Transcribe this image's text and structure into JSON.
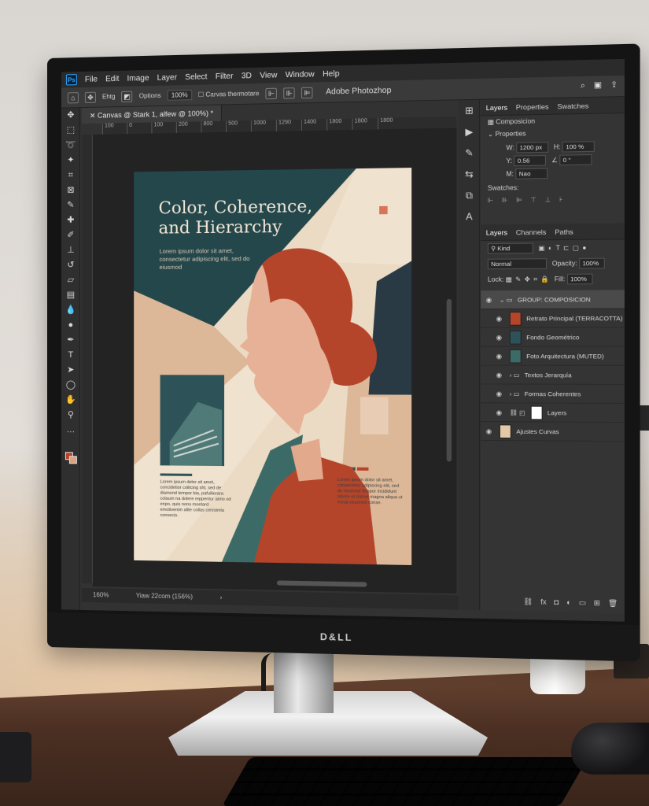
{
  "app": {
    "title": "Adobe Photozhop",
    "logo": "Ps",
    "monitor_brand": "D&LL"
  },
  "menu": [
    "File",
    "Edit",
    "Image",
    "Layer",
    "Select",
    "Filter",
    "3D",
    "View",
    "Window",
    "Help"
  ],
  "options_bar": {
    "options_label": "Options",
    "zoom_value": "100%",
    "canvas_checkbox_label": "Carvas thermotare",
    "brush_label": "Ehtg"
  },
  "document": {
    "tab_label": "Canvas @ Stark 1, alfew @ 100%) *",
    "ruler_ticks": [
      "100",
      "0",
      "100",
      "200",
      "800",
      "500",
      "1000",
      "1290",
      "1400",
      "1800",
      "1800",
      "1800"
    ],
    "status_zoom": "160%",
    "status_doc": "Yiaw 22com (156%)"
  },
  "poster": {
    "title": "Color, Coherence, and Hierarchy",
    "subtitle": "Lorem ipsum dolor sit amet, consectetur adipiscing elit, sed do eiusmod",
    "body_left": "Lorem ipsum deler sit amet, concidetior coilicing sht, sed de diamond tempor bia, pafuiliorara colaum na dolere reppentur aimo od enpo, quis nons moetard emotivenim alite collas cenlsimla consecis.",
    "body_right": "Lorem ipsum dolor sit amet, consectetur adipiscing elit, sed do eiusmod tempor incididunt labore et dolore magna aliqua ut ennat eiusmod conse."
  },
  "properties_panel": {
    "tabs": [
      "Layers",
      "Properties",
      "Swatches"
    ],
    "composite_label": "Composicion",
    "section_label": "Properties",
    "w_value": "1200 px",
    "h_value": "100 %",
    "y_value": "0.56",
    "angle_value": "0 °",
    "misc_value": "Nao",
    "swatches_label": "Swatches:"
  },
  "layers_panel": {
    "tabs": [
      "Layers",
      "Channels",
      "Paths"
    ],
    "filter_label": "Kind",
    "blend_mode": "Normal",
    "opacity_label": "Opacity:",
    "opacity_value": "100%",
    "lock_label": "Lock:",
    "fill_label": "Fill:",
    "fill_value": "100%",
    "layers": [
      {
        "name": "GROUP: COMPOSICION",
        "thumb": "#cfcfcf",
        "selected": true
      },
      {
        "name": "Retrato Principal (TERRACOTTA)",
        "thumb": "#b5452a"
      },
      {
        "name": "Fondo Geométrico",
        "thumb": "#2d5358"
      },
      {
        "name": "Foto Arquitectura (MUTED)",
        "thumb": "#3c6a66"
      },
      {
        "name": "Textos Jerarquía",
        "thumb": "#5a5a5a"
      },
      {
        "name": "Formas Coherentes",
        "thumb": "#5a5a5a"
      },
      {
        "name": "Layers",
        "thumb": "#ffffff"
      },
      {
        "name": "Ajustes Curvas",
        "thumb": "#e2c9a8"
      }
    ]
  },
  "colors": {
    "teal": "#24474c",
    "terracotta": "#b5452a",
    "cream": "#ecdbc4",
    "sand": "#dcb898"
  }
}
